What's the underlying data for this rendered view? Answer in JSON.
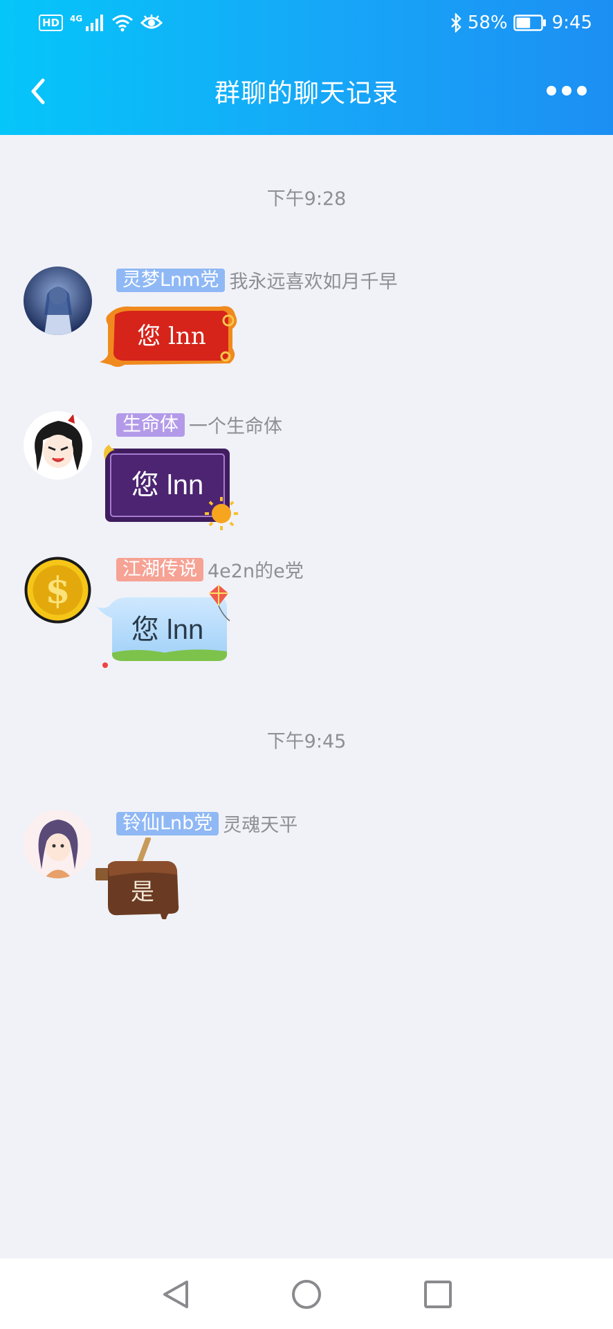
{
  "status_bar": {
    "left_badge": "HD",
    "signal_type": "4G",
    "battery_percent": "58%",
    "time": "9:45",
    "battery_level": 0.58
  },
  "header": {
    "title": "群聊的聊天记录",
    "gradient_start": "#05c6f9",
    "gradient_end": "#1c8ff3"
  },
  "chat": {
    "timestamps": [
      "下午9:28",
      "下午9:45"
    ],
    "messages": [
      {
        "badge": "灵梦Lnm党",
        "badge_color": "#8fb8f5",
        "nickname": "我永远喜欢如月千早",
        "text": "您 lnn",
        "bubble_style": "red-scroll"
      },
      {
        "badge": "生命体",
        "badge_color": "#b39ae9",
        "nickname": "一个生命体",
        "text": "您 lnn",
        "bubble_style": "purple-frame"
      },
      {
        "badge": "江湖传说",
        "badge_color": "#f6a294",
        "nickname": "4e2n的e党",
        "text": "您 lnn",
        "bubble_style": "sky-kite"
      },
      {
        "badge": "铃仙Lnb党",
        "badge_color": "#8fb8f5",
        "nickname": "灵魂天平",
        "text": "是",
        "bubble_style": "chocolate-sticker"
      }
    ]
  },
  "navigation": {
    "back_icon": "triangle-back-icon",
    "home_icon": "circle-home-icon",
    "recent_icon": "square-recents-icon"
  }
}
